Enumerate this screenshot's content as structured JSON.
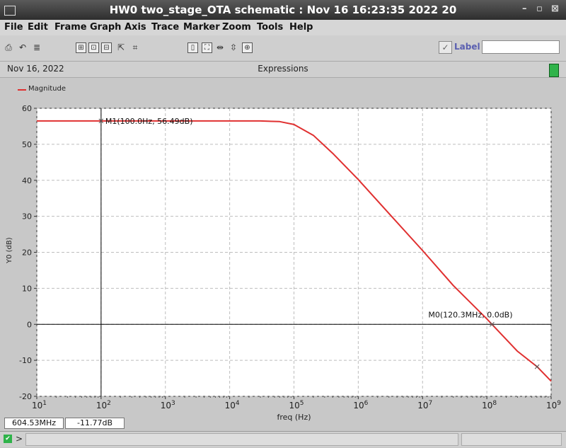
{
  "window": {
    "title": "HW0 two_stage_OTA schematic : Nov 16 16:23:35 2022 20",
    "minimize": "–",
    "restore": "▫",
    "close": "⊠"
  },
  "menu": [
    "File",
    "Edit",
    "Frame",
    "Graph",
    "Axis",
    "Trace",
    "Marker",
    "Zoom",
    "Tools",
    "Help"
  ],
  "toolbar": {
    "label_text": "Label",
    "label_value": "",
    "icons": [
      "print-icon",
      "undo-icon",
      "table-icon",
      "graph-tool-icon",
      "graph-tool-icon",
      "graph-tool-icon",
      "graph-tool-icon",
      "graph-tool-icon",
      "zoom-icon",
      "fit-icon",
      "zoom-x-icon",
      "zoom-y-icon",
      "zoom-box-icon"
    ]
  },
  "header": {
    "date": "Nov 16, 2022",
    "panel": "Expressions"
  },
  "legend": {
    "label": "Magnitude",
    "color": "#e03030"
  },
  "readout": {
    "x": "604.53MHz",
    "y": "-11.77dB"
  },
  "status": {
    "prompt": ">"
  },
  "chart_data": {
    "type": "line",
    "xlabel": "freq (Hz)",
    "ylabel": "Y0 (dB)",
    "xscale": "log",
    "xlim": [
      10,
      1000000000
    ],
    "ylim": [
      -20,
      60
    ],
    "yticks": [
      -20,
      -10,
      0,
      10,
      20,
      30,
      40,
      50,
      60
    ],
    "xticks": [
      {
        "value": 10,
        "base": "10",
        "exp": "1"
      },
      {
        "value": 100,
        "base": "10",
        "exp": "2"
      },
      {
        "value": 1000,
        "base": "10",
        "exp": "3"
      },
      {
        "value": 10000,
        "base": "10",
        "exp": "4"
      },
      {
        "value": 100000,
        "base": "10",
        "exp": "5"
      },
      {
        "value": 1000000,
        "base": "10",
        "exp": "6"
      },
      {
        "value": 10000000,
        "base": "10",
        "exp": "7"
      },
      {
        "value": 100000000,
        "base": "10",
        "exp": "8"
      },
      {
        "value": 1000000000,
        "base": "10",
        "exp": "9"
      }
    ],
    "grid": true,
    "series": [
      {
        "name": "Magnitude",
        "color": "#e03030",
        "x": [
          10,
          100,
          1000,
          10000,
          30000,
          60000,
          100000,
          200000,
          400000,
          1000000,
          3000000,
          10000000,
          30000000,
          100000000,
          120300000,
          300000000,
          604530000,
          1000000000
        ],
        "y": [
          56.49,
          56.49,
          56.49,
          56.49,
          56.49,
          56.3,
          55.5,
          52.5,
          47.5,
          40.2,
          30.8,
          20.5,
          10.8,
          1.5,
          0.0,
          -7.5,
          -11.77,
          -15.8
        ]
      }
    ],
    "markers": [
      {
        "name": "M1",
        "label": "M1(100.0Hz, 56.49dB)",
        "x": 100,
        "y": 56.49
      },
      {
        "name": "M0",
        "label": "M0(120.3MHz, 0.0dB)",
        "x": 120300000,
        "y": 0.0
      }
    ],
    "crosshair": {
      "x": 100,
      "y": 0
    }
  }
}
